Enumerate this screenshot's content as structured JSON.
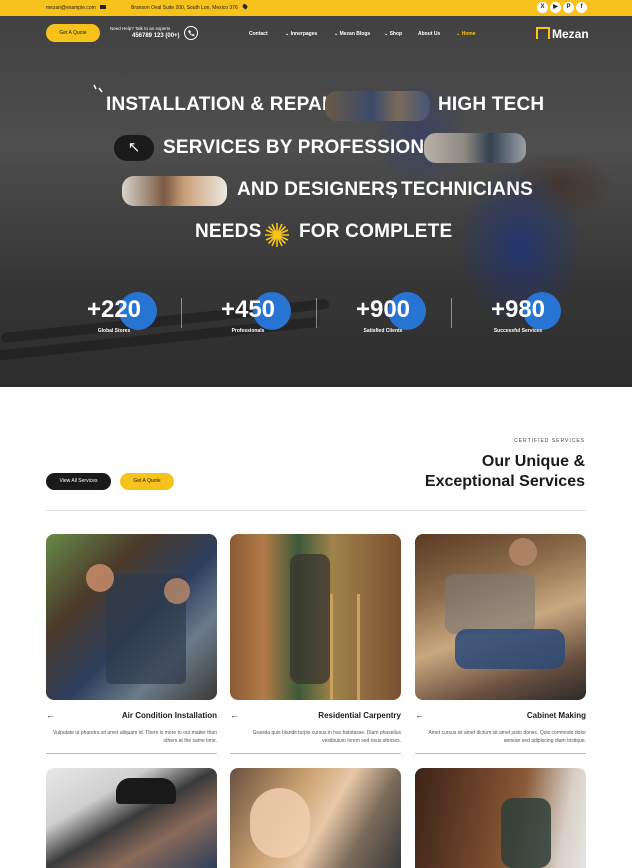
{
  "topbar": {
    "email": "mezan@example.com",
    "address": "Branson Oval Suite 200, South Lon, Mexico 376",
    "socials": [
      {
        "icon": "x-icon",
        "glyph": "X"
      },
      {
        "icon": "youtube-icon",
        "glyph": "▶"
      },
      {
        "icon": "pinterest-icon",
        "glyph": "P"
      },
      {
        "icon": "facebook-icon",
        "glyph": "f"
      }
    ]
  },
  "header": {
    "quote_button": "Get A Quote",
    "help_label": "Need Help? Talk to an experts",
    "phone": "456789 123 (00+)",
    "nav": [
      {
        "label": "Contact"
      },
      {
        "label": "Innerpages"
      },
      {
        "label": "Mezan Blogs"
      },
      {
        "label": "Shop"
      },
      {
        "label": "About Us"
      },
      {
        "label": "Home"
      }
    ],
    "logo_text": "Mezan"
  },
  "hero": {
    "line1a": "INSTALLATION & REPAIR",
    "line1b": "HIGH TECH",
    "line2": "SERVICES BY PROFESSIONAL",
    "line3a": "AND DESIGNERS",
    "line3b": ", TECHNICIANS",
    "line4a": "NEEDS",
    "line4b": "FOR COMPLETE",
    "arrow_glyph": "↖",
    "stats": [
      {
        "number": "+220",
        "label": "Global Stores"
      },
      {
        "number": "+450",
        "label": "Professionals"
      },
      {
        "number": "+900",
        "label": "Satisfied Clients"
      },
      {
        "number": "+980",
        "label": "Successful Services"
      }
    ]
  },
  "services": {
    "eyebrow": "CERTIFIED SERVICES",
    "title_line1": "Our Unique &",
    "title_line2": "Exceptional Services",
    "view_all_button": "View All Services",
    "quote_button": "Get A Quote",
    "arrow_glyph": "←",
    "cards": [
      {
        "title": "Air Condition Installation",
        "desc": "Vulputate ut pharetra sit amet aliquam id. There is more to our matter than others at the same time."
      },
      {
        "title": "Residential Carpentry",
        "desc": "Gravida quis blandit turpis cursus in hac habitasse. Diam phasellus vestibulum lorem sed risus ultricies."
      },
      {
        "title": "Cabinet Making",
        "desc": "Amet cursus sit amet dictum sit amet justo donec. Quiz commodo dolor aenean sed adipiscing diam tristique."
      }
    ]
  },
  "colors": {
    "accent": "#f7c21b",
    "blue": "#2774d3",
    "dark": "#1a1a1a"
  }
}
